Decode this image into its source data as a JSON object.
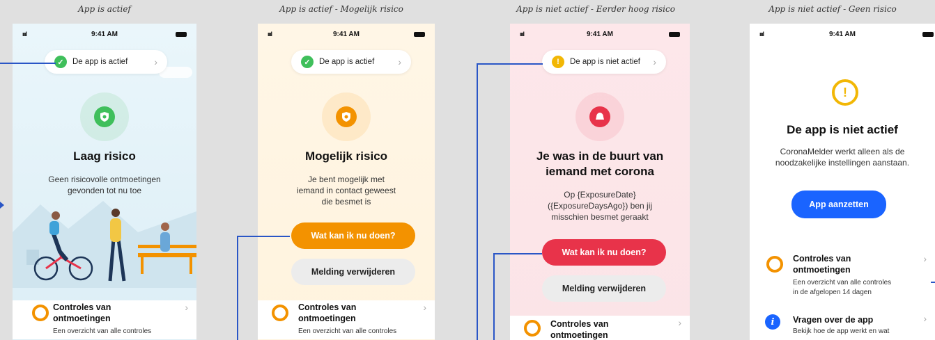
{
  "captions": [
    "App is actief",
    "App is actief - Mogelijk risico",
    "App is niet actief - Eerder hoog risico",
    "App is niet actief - Geen risico"
  ],
  "status_bar": {
    "signal": "ıııl",
    "time": "9:41 AM"
  },
  "screen1": {
    "pill_text": "De app is actief",
    "title": "Laag risico",
    "description": "Geen risicovolle ontmoetingen\ngevonden tot nu toe",
    "row_title": "Controles van\nontmoetingen",
    "row_subtitle": "Een overzicht van alle controles"
  },
  "screen2": {
    "pill_text": "De app is actief",
    "title": "Mogelijk risico",
    "description": "Je bent mogelijk met\niemand in contact geweest\ndie besmet is",
    "primary_button": "Wat kan ik nu doen?",
    "secondary_button": "Melding verwijderen",
    "row_title": "Controles van\nontmoetingen",
    "row_subtitle": "Een overzicht van alle controles"
  },
  "screen3": {
    "pill_text": "De app is niet actief",
    "title": "Je was in de buurt van\niemand met corona",
    "description": "Op {ExposureDate}\n({ExposureDaysAgo}) ben jij\nmisschien besmet geraakt",
    "primary_button": "Wat kan ik nu doen?",
    "secondary_button": "Melding verwijderen",
    "row_title": "Controles van\nontmoetingen"
  },
  "screen4": {
    "exclamation": "!",
    "title": "De app is niet actief",
    "description": "CoronaMelder werkt alleen als de\nnoodzakelijke instellingen aanstaan.",
    "primary_button": "App aanzetten",
    "row1_title": "Controles van\nontmoetingen",
    "row1_subtitle": "Een overzicht van alle controles\nin de afgelopen 14 dagen",
    "row2_title": "Vragen over de app",
    "row2_subtitle": "Bekijk hoe de app werkt en wat"
  },
  "icons": {
    "check": "✓",
    "exclamation": "!",
    "chevron": "›",
    "info": "i"
  },
  "colors": {
    "green": "#3fbf5b",
    "orange": "#f39200",
    "red": "#e8334a",
    "blue": "#1a64ff",
    "connector": "#2a56c6"
  }
}
